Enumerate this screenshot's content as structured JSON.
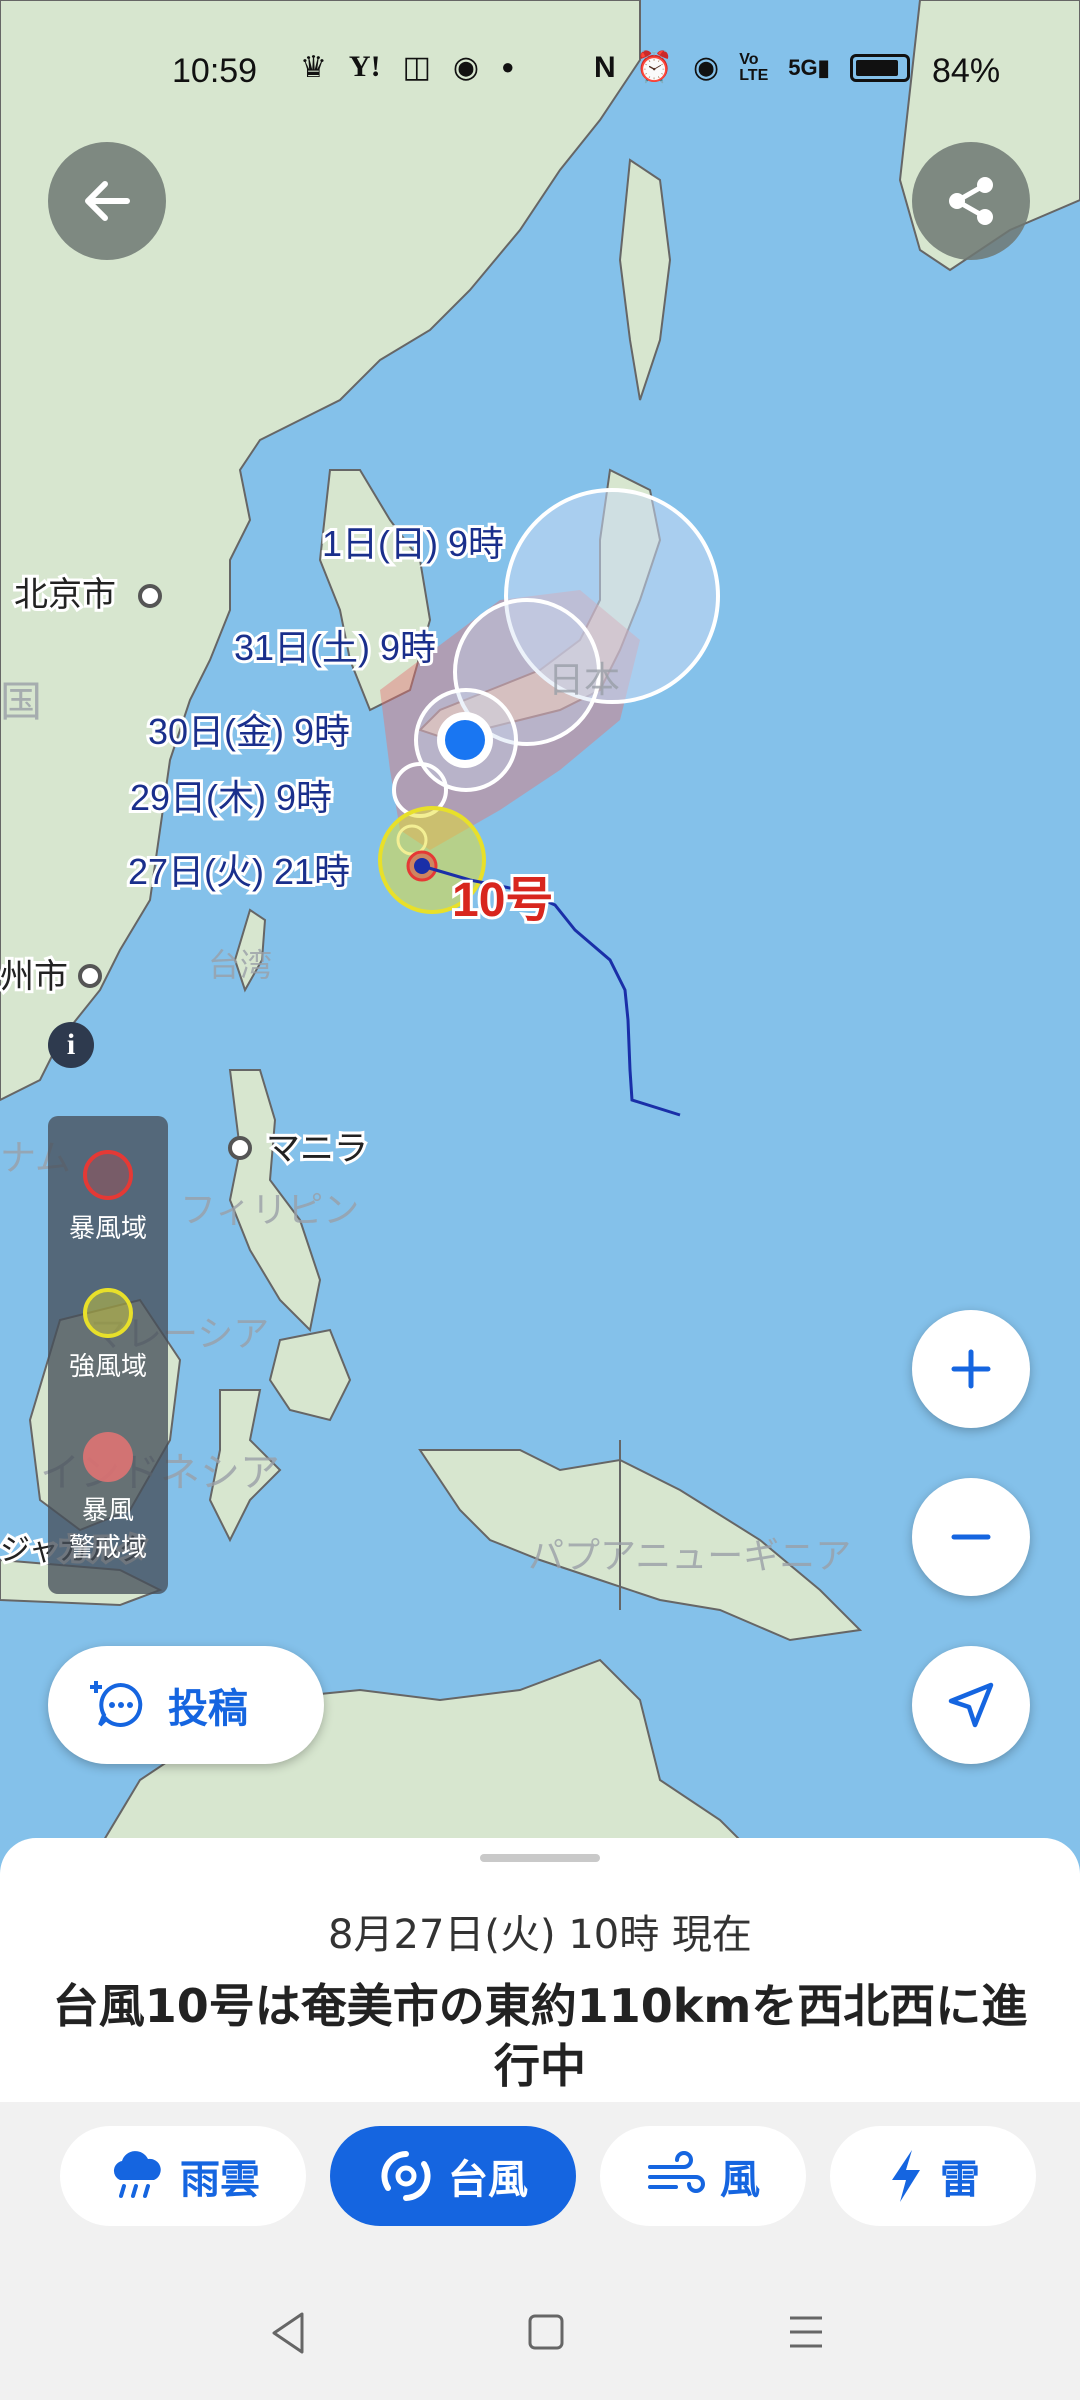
{
  "status_bar": {
    "time": "10:59",
    "battery_percent": "84%",
    "left_icons": [
      "notification-icon",
      "yahoo-icon",
      "tv-icon",
      "chrome-icon",
      "dot-icon"
    ],
    "right_icons": [
      "nfc-icon",
      "alarm-icon",
      "location-icon",
      "volte-icon",
      "5g-signal-icon",
      "battery-icon"
    ]
  },
  "map": {
    "place_labels": {
      "beijing": "北京市",
      "china": "国",
      "fuzhou": "州市",
      "taiwan": "台湾",
      "manila": "マニラ",
      "philippines": "フィリピン",
      "vietnam": "ナム",
      "malaysia": "マレーシア",
      "indonesia": "インドネシア",
      "japan": "日本",
      "jakarta": "ジャカルタ",
      "papua": "パプアニューギニア"
    },
    "forecast_labels": [
      "1日(日) 9時",
      "31日(土) 9時",
      "30日(金) 9時",
      "29日(木) 9時",
      "27日(火) 21時"
    ],
    "typhoon_label": "10号",
    "colors": {
      "storm_zone": "#e53935",
      "strong_wind_zone": "#e8e02a",
      "warning_zone": "#e57373",
      "track": "#1a2fa8",
      "current_position": "#1976f2",
      "sea": "#84c1ea",
      "land": "#d7e6cf"
    }
  },
  "legend": {
    "items": [
      {
        "label": "暴風域",
        "color": "#e53935"
      },
      {
        "label": "強風域",
        "color": "#e8e02a"
      },
      {
        "label_line1": "暴風",
        "label_line2": "警戒域",
        "color": "#e57373"
      }
    ]
  },
  "buttons": {
    "back_icon": "arrow-left-icon",
    "share_icon": "share-icon",
    "info_icon": "info-icon",
    "zoom_in_icon": "plus-icon",
    "zoom_out_icon": "minus-icon",
    "locate_icon": "navigation-arrow-icon",
    "post_label": "投稿"
  },
  "sheet": {
    "datetime": "8月27日(火) 10時 現在",
    "headline": "台風10号は奄美市の東約110kmを西北西に進行中"
  },
  "tabs": [
    {
      "label": "雨雲",
      "icon": "rain-cloud-icon",
      "active": false
    },
    {
      "label": "台風",
      "icon": "typhoon-icon",
      "active": true
    },
    {
      "label": "風",
      "icon": "wind-icon",
      "active": false
    },
    {
      "label": "雷",
      "icon": "lightning-icon",
      "active": false
    }
  ],
  "navbar": {
    "icons": [
      "back-triangle-icon",
      "home-square-icon",
      "menu-lines-icon"
    ]
  }
}
